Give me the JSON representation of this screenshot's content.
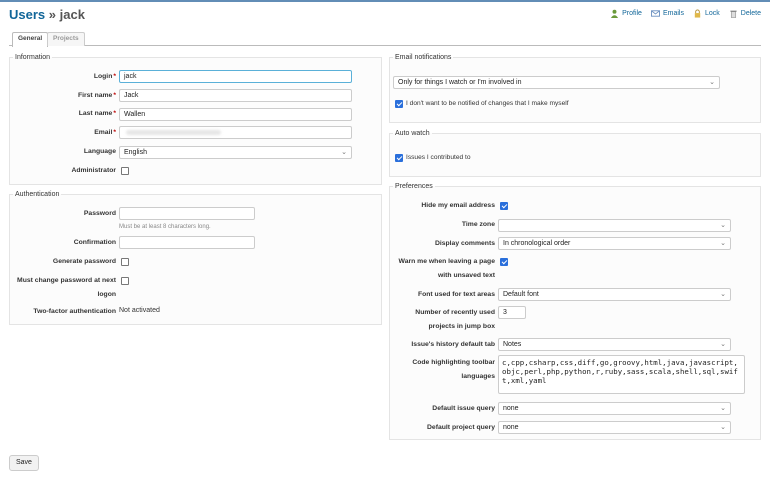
{
  "header": {
    "breadcrumb": "Users",
    "separator": "»",
    "user": "jack",
    "actions": [
      {
        "label": "Profile",
        "icon": "user-icon"
      },
      {
        "label": "Emails",
        "icon": "email-icon"
      },
      {
        "label": "Lock",
        "icon": "lock-icon"
      },
      {
        "label": "Delete",
        "icon": "trash-icon"
      }
    ]
  },
  "tabs": [
    {
      "label": "General",
      "selected": true
    },
    {
      "label": "Projects",
      "selected": false
    }
  ],
  "information": {
    "legend": "Information",
    "login": {
      "label": "Login",
      "value": "jack",
      "required": "*"
    },
    "firstname": {
      "label": "First name",
      "value": "Jack",
      "required": "*"
    },
    "lastname": {
      "label": "Last name",
      "value": "Wallen",
      "required": "*"
    },
    "email": {
      "label": "Email",
      "required": "*"
    },
    "language": {
      "label": "Language",
      "value": "English"
    },
    "admin": {
      "label": "Administrator",
      "checked": false
    }
  },
  "authentication": {
    "legend": "Authentication",
    "password": {
      "label": "Password",
      "hint": "Must be at least 8 characters long."
    },
    "confirmation": {
      "label": "Confirmation"
    },
    "generate": {
      "label": "Generate password",
      "checked": false
    },
    "must_change": {
      "label_line1": "Must change password at next",
      "label_line2": "logon",
      "checked": false
    },
    "twofa": {
      "label": "Two-factor authentication",
      "value": "Not activated"
    }
  },
  "email_notifications": {
    "legend": "Email notifications",
    "selected": "Only for things I watch or I'm involved in",
    "no_self": {
      "label": "I don't want to be notified of changes that I make myself",
      "checked": true
    }
  },
  "auto_watch": {
    "legend": "Auto watch",
    "issues": {
      "label": "Issues I contributed to",
      "checked": true
    }
  },
  "preferences": {
    "legend": "Preferences",
    "hide_email": {
      "label": "Hide my email address",
      "checked": true
    },
    "time_zone": {
      "label": "Time zone",
      "value": ""
    },
    "display_comments": {
      "label": "Display comments",
      "value": "In chronological order"
    },
    "warn_leaving": {
      "label_line1": "Warn me when leaving a page",
      "label_line2": "with unsaved text",
      "checked": true
    },
    "font": {
      "label": "Font used for text areas",
      "value": "Default font"
    },
    "recent_projects": {
      "label_line1": "Number of recently used",
      "label_line2": "projects in jump box",
      "value": "3"
    },
    "history_tab": {
      "label": "Issue's history default tab",
      "value": "Notes"
    },
    "code_toolbar": {
      "label_line1": "Code highlighting toolbar",
      "label_line2": "languages",
      "value": "c,cpp,csharp,css,diff,go,groovy,html,java,javascript,objc,perl,php,python,r,ruby,sass,scala,shell,sql,swift,xml,yaml"
    },
    "default_issue_query": {
      "label": "Default issue query",
      "value": "none"
    },
    "default_project_query": {
      "label": "Default project query",
      "value": "none"
    }
  },
  "save_label": "Save",
  "colors": {
    "link": "#116699",
    "accent_line": "#628db6",
    "checkbox": "#2a6fdb"
  }
}
